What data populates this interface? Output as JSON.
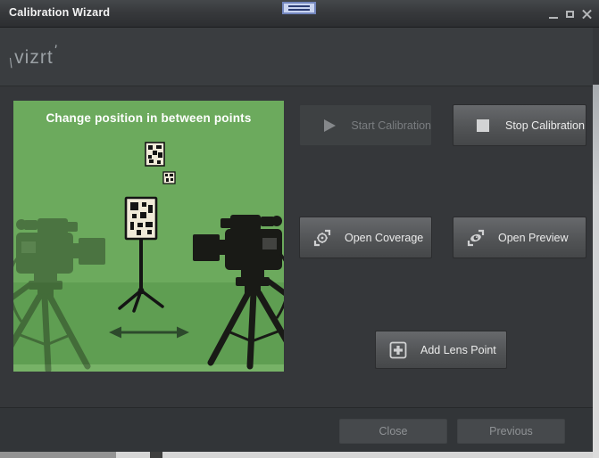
{
  "window": {
    "title": "Calibration Wizard"
  },
  "logo": {
    "prefix": "\\",
    "text": "vizrt",
    "suffix": "'"
  },
  "illustration": {
    "heading": "Change position in between points"
  },
  "actions": {
    "start": {
      "label": "Start Calibration",
      "enabled": false
    },
    "stop": {
      "label": "Stop Calibration",
      "enabled": true
    },
    "coverage": {
      "label": "Open Coverage",
      "enabled": true
    },
    "preview": {
      "label": "Open Preview",
      "enabled": true
    },
    "add_lens_point": {
      "label": "Add Lens Point",
      "enabled": true
    }
  },
  "footer": {
    "close_label": "Close",
    "previous_label": "Previous"
  },
  "icons": {
    "start": "play-icon",
    "stop": "stop-square-icon",
    "coverage": "coverage-target-icon",
    "preview": "eye-preview-icon",
    "add_lens_point": "plus-box-icon"
  },
  "colors": {
    "panel_green": "#6caa5d",
    "ground_green": "#5f9e52",
    "titlebar_text": "#f2f2f2",
    "button_text": "#ebebeb",
    "disabled_text": "#7a7d80",
    "footer_text": "#8f9295",
    "logo_gray": "#9aa0a4",
    "drag_handle_blue": "#c9d4f0"
  }
}
